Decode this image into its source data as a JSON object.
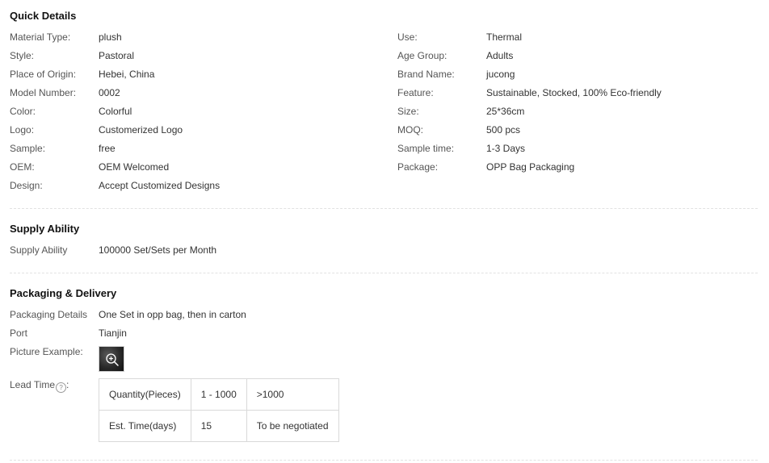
{
  "quick_details": {
    "title": "Quick Details",
    "left": [
      {
        "label": "Material Type:",
        "value": "plush"
      },
      {
        "label": "Style:",
        "value": "Pastoral"
      },
      {
        "label": "Place of Origin:",
        "value": "Hebei, China"
      },
      {
        "label": "Model Number:",
        "value": "0002"
      },
      {
        "label": "Color:",
        "value": "Colorful"
      },
      {
        "label": "Logo:",
        "value": "Customerized Logo"
      },
      {
        "label": "Sample:",
        "value": "free"
      },
      {
        "label": "OEM:",
        "value": "OEM Welcomed"
      },
      {
        "label": "Design:",
        "value": "Accept Customized Designs"
      }
    ],
    "right": [
      {
        "label": "Use:",
        "value": "Thermal"
      },
      {
        "label": "Age Group:",
        "value": "Adults"
      },
      {
        "label": "Brand Name:",
        "value": "jucong"
      },
      {
        "label": "Feature:",
        "value": "Sustainable, Stocked, 100% Eco-friendly"
      },
      {
        "label": "Size:",
        "value": "25*36cm"
      },
      {
        "label": "MOQ:",
        "value": "500 pcs"
      },
      {
        "label": "Sample time:",
        "value": "1-3 Days"
      },
      {
        "label": "Package:",
        "value": "OPP Bag Packaging"
      }
    ]
  },
  "supply_ability": {
    "title": "Supply Ability",
    "label": "Supply Ability",
    "value": "100000 Set/Sets per Month"
  },
  "packaging_delivery": {
    "title": "Packaging & Delivery",
    "packaging_details_label": "Packaging Details",
    "packaging_details_value": "One Set in opp bag, then in carton",
    "port_label": "Port",
    "port_value": "Tianjin",
    "picture_example_label": "Picture Example:",
    "picture_icon": "zoom-in-icon",
    "lead_time_label": "Lead Time",
    "lead_time_suffix": ":",
    "help_icon_glyph": "?",
    "lead_table": {
      "rows": [
        [
          "Quantity(Pieces)",
          "1 - 1000",
          ">1000"
        ],
        [
          "Est. Time(days)",
          "15",
          "To be negotiated"
        ]
      ]
    }
  }
}
